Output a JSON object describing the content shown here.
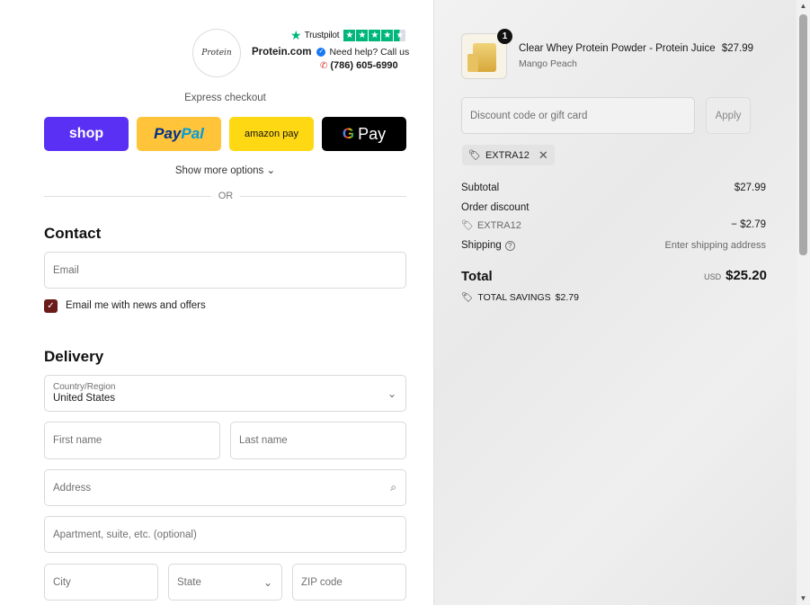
{
  "header": {
    "logo_mark": "Protein",
    "trustpilot_label": "Trustpilot",
    "trustpilot_rating": 4.5,
    "brand": "Protein.com",
    "help_text": "Need help? Call us",
    "phone": "(786) 605-6990"
  },
  "express": {
    "title": "Express checkout",
    "buttons": {
      "shop": "shop",
      "paypal_a": "Pay",
      "paypal_b": "Pal",
      "amazon": "amazon pay",
      "google_g": "G",
      "google_pay": "Pay"
    },
    "show_more": "Show more options ⌄",
    "or": "OR"
  },
  "contact": {
    "title": "Contact",
    "email_placeholder": "Email",
    "newsletter_label": "Email me with news and offers",
    "newsletter_checked": true
  },
  "delivery": {
    "title": "Delivery",
    "country_label": "Country/Region",
    "country_value": "United States",
    "first_name": "First name",
    "last_name": "Last name",
    "address": "Address",
    "apartment": "Apartment, suite, etc. (optional)",
    "city": "City",
    "state": "State",
    "zip": "ZIP code"
  },
  "order": {
    "item": {
      "quantity": "1",
      "name": "Clear Whey Protein Powder - Protein Juice",
      "variant": "Mango Peach",
      "price": "$27.99"
    },
    "discount_placeholder": "Discount code or gift card",
    "apply": "Apply",
    "applied_code": "EXTRA12",
    "subtotal_label": "Subtotal",
    "subtotal_value": "$27.99",
    "order_discount_label": "Order discount",
    "discount_code": "EXTRA12",
    "discount_value": "− $2.79",
    "shipping_label": "Shipping",
    "shipping_value": "Enter shipping address",
    "total_label": "Total",
    "currency": "USD",
    "total_value": "$25.20",
    "savings_label": "TOTAL SAVINGS",
    "savings_value": "$2.79"
  },
  "colors": {
    "shop": "#5a31f4",
    "paypal": "#ffc439",
    "amazon": "#ffd814",
    "google": "#000000",
    "checkbox": "#6b1a1a",
    "trustpilot": "#00b67a"
  }
}
